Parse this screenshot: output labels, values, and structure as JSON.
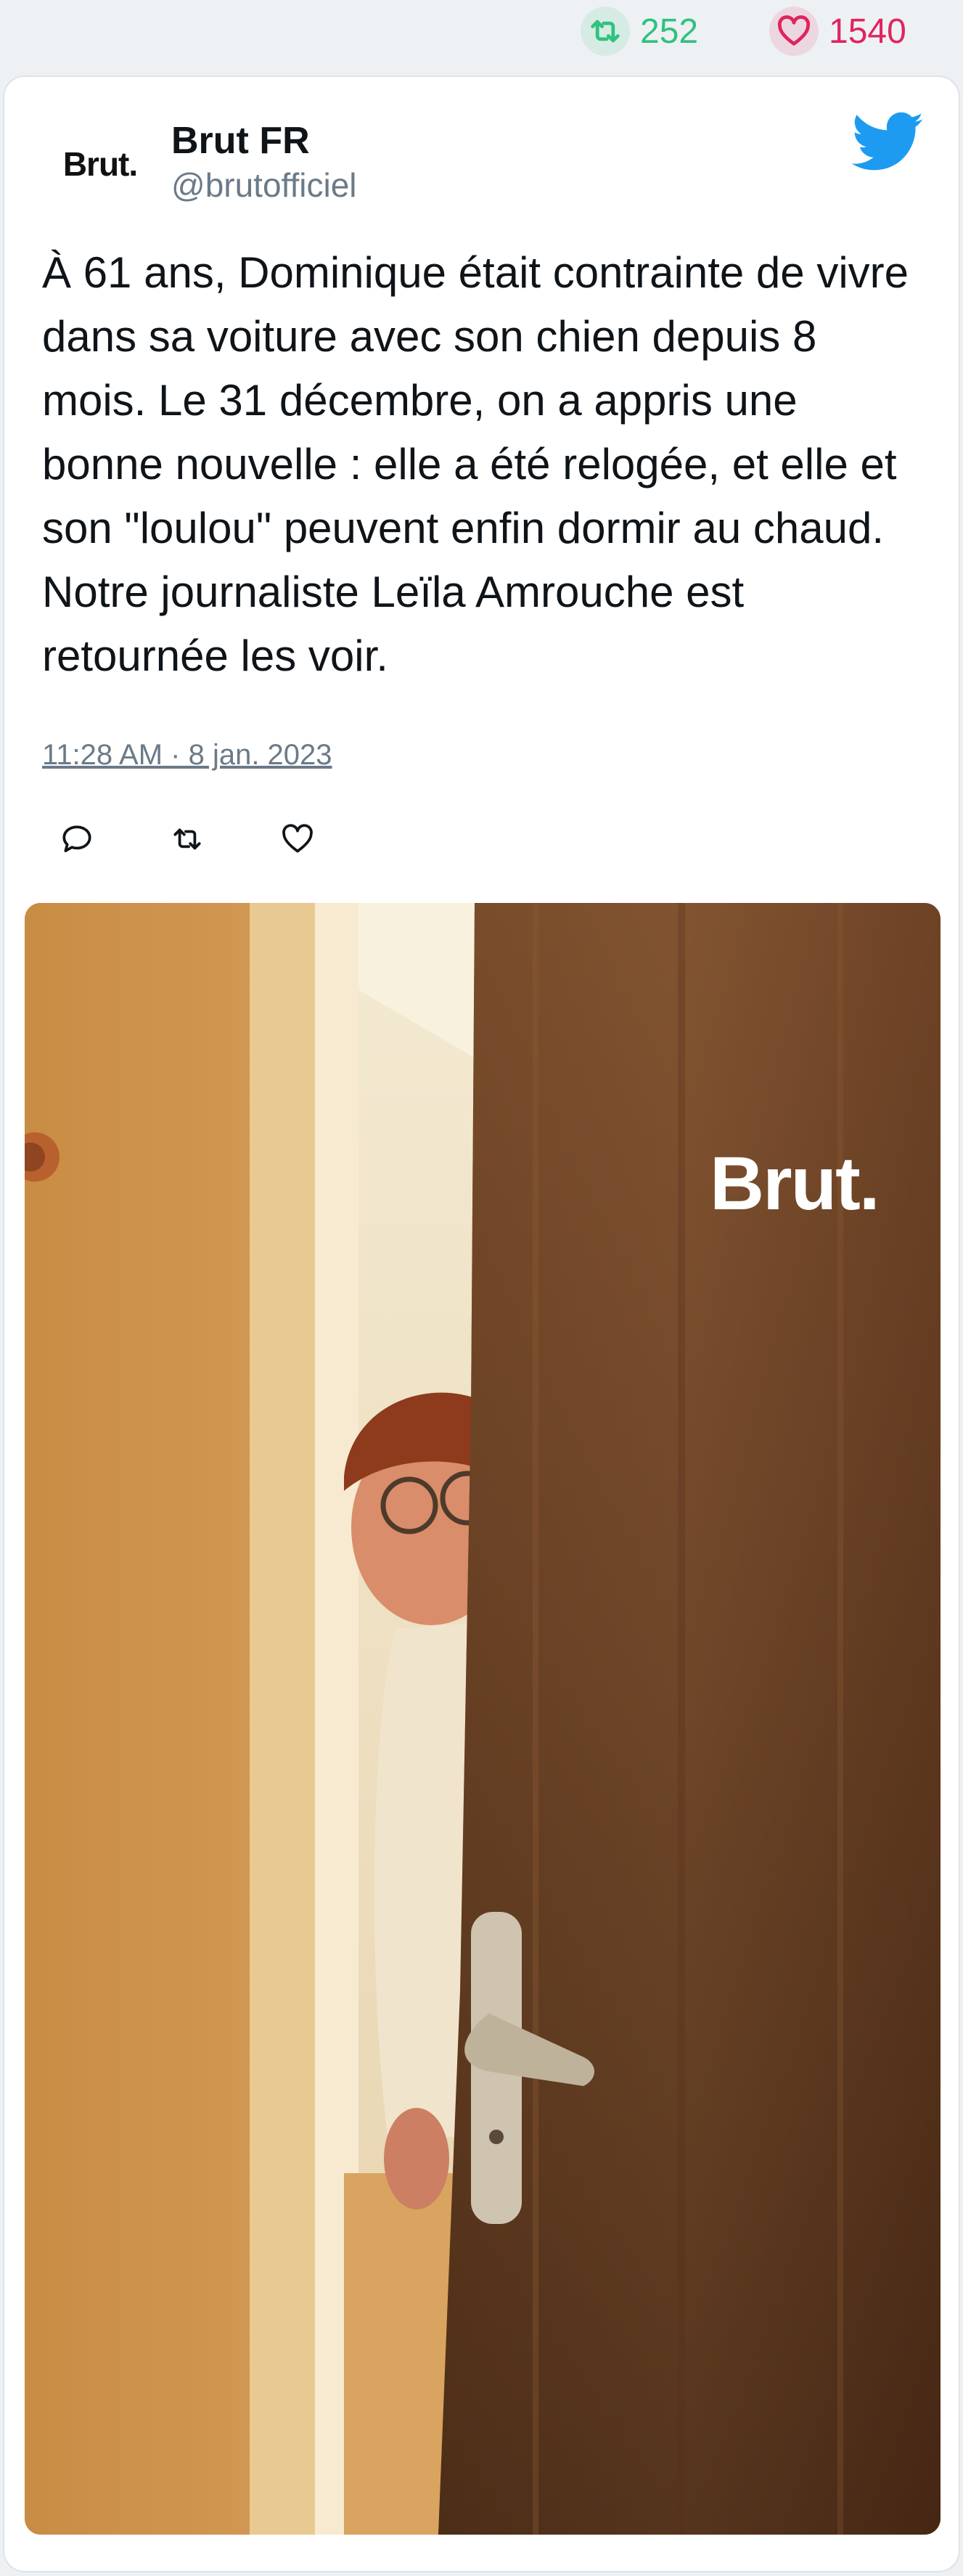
{
  "stats": {
    "retweets": "252",
    "likes": "1540",
    "retweet_icon": "retweet-icon",
    "like_icon": "heart-icon"
  },
  "tweet": {
    "author": {
      "avatar_text": "Brut.",
      "name": "Brut FR",
      "handle": "@brutofficiel"
    },
    "text": "À 61 ans, Dominique était contrainte de vivre dans sa voiture avec son chien depuis 8 mois. Le 31 décembre, on a appris une bonne nouvelle : elle a été relogée, et elle et son \"loulou\" peuvent enfin dormir au chaud. Notre journaliste Leïla Amrouche est retournée les voir.",
    "date": "11:28 AM · 8 jan. 2023",
    "actions": [
      "reply-icon",
      "retweet-icon",
      "heart-icon"
    ],
    "media": {
      "description_icon": "photo",
      "watermark": "Brut."
    }
  },
  "colors": {
    "retweet": "#2fc27f",
    "like": "#e0245e",
    "twitter_blue": "#1d9bf0",
    "muted_text": "#6b7a88"
  }
}
